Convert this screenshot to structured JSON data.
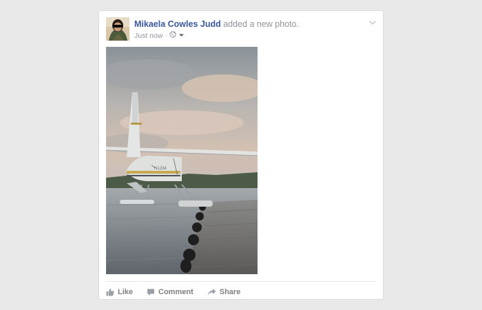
{
  "post": {
    "author_name": "Mikaela Cowles Judd",
    "action_text": "added a new photo.",
    "timestamp": "Just now",
    "separator": "·",
    "privacy_icon": "globe-icon",
    "menu_icon": "chevron-down-icon"
  },
  "actions": {
    "like_label": "Like",
    "comment_label": "Comment",
    "share_label": "Share"
  },
  "colors": {
    "link_blue": "#3b5998",
    "meta_gray": "#90949c",
    "action_gray": "#7f7f7f"
  }
}
